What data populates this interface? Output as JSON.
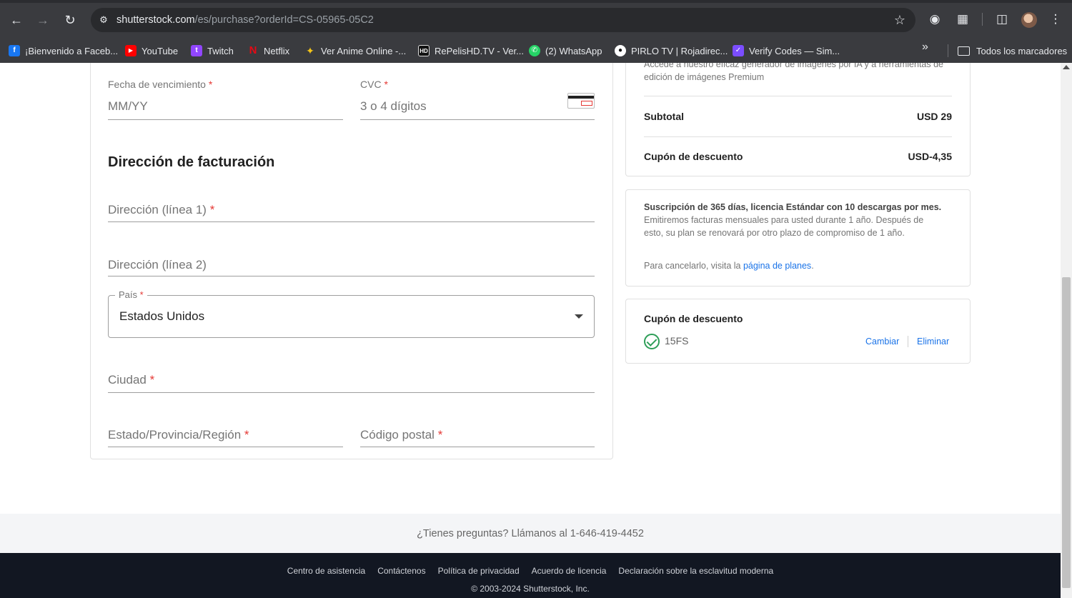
{
  "browser": {
    "url_host": "shutterstock.com",
    "url_path": "/es/purchase?orderId=CS-05965-05C2",
    "bookmarks": [
      {
        "label": "¡Bienvenido a Faceb...",
        "icon": "facebook-icon",
        "color": "#1877f2"
      },
      {
        "label": "YouTube",
        "icon": "youtube-icon",
        "color": "#ff0000"
      },
      {
        "label": "Twitch",
        "icon": "twitch-icon",
        "color": "#9146ff"
      },
      {
        "label": "Netflix",
        "icon": "netflix-icon",
        "color": "#e50914"
      },
      {
        "label": "Ver Anime Online -...",
        "icon": "anime-icon",
        "color": "#f5c518"
      },
      {
        "label": "RePelisHD.TV - Ver...",
        "icon": "hd-icon",
        "color": "#111111"
      },
      {
        "label": "(2) WhatsApp",
        "icon": "whatsapp-icon",
        "color": "#25d366"
      },
      {
        "label": "PIRLO TV | Rojadirec...",
        "icon": "soccer-ball-icon",
        "color": "#ffffff"
      },
      {
        "label": "Verify Codes — Sim...",
        "icon": "verify-codes-icon",
        "color": "#7b4dff"
      }
    ],
    "all_bookmarks_label": "Todos los marcadores"
  },
  "payment": {
    "expiry_label": "Fecha de vencimiento",
    "expiry_placeholder": "MM/YY",
    "cvc_label": "CVC",
    "cvc_placeholder": "3 o 4 dígitos",
    "required_mark": "*"
  },
  "billing": {
    "title": "Dirección de facturación",
    "address1_label": "Dirección (línea 1)",
    "address2_label": "Dirección (línea 2)",
    "country_label": "País",
    "country_value": "Estados Unidos",
    "city_label": "Ciudad",
    "state_label": "Estado/Provincia/Región",
    "postal_label": "Código postal"
  },
  "summary": {
    "premium_text": "Accede a nuestro eficaz generador de imágenes por IA y a herramientas de edición de imágenes Premium",
    "subtotal_label": "Subtotal",
    "subtotal_value": "USD 29",
    "coupon_label": "Cupón de descuento",
    "coupon_value": "USD-4,35"
  },
  "subscription": {
    "bold_text": "Suscripción de 365 días, licencia Estándar con 10 descargas por mes.",
    "detail_text": " Emitiremos facturas mensuales para usted durante 1 año. Después de esto, su plan se renovará por otro plazo de compromiso de 1 año.",
    "cancel_prefix": "Para cancelarlo, visita la ",
    "cancel_link": "página de planes",
    "cancel_suffix": "."
  },
  "coupon": {
    "title": "Cupón de descuento",
    "code": "15FS",
    "change_label": "Cambiar",
    "remove_label": "Eliminar"
  },
  "help": {
    "text": "¿Tienes preguntas? Llámanos al 1-646-419-4452"
  },
  "footer": {
    "links": [
      "Centro de asistencia",
      "Contáctenos",
      "Política de privacidad",
      "Acuerdo de licencia",
      "Declaración sobre la esclavitud moderna"
    ],
    "copyright": "© 2003-2024 Shutterstock, Inc."
  }
}
